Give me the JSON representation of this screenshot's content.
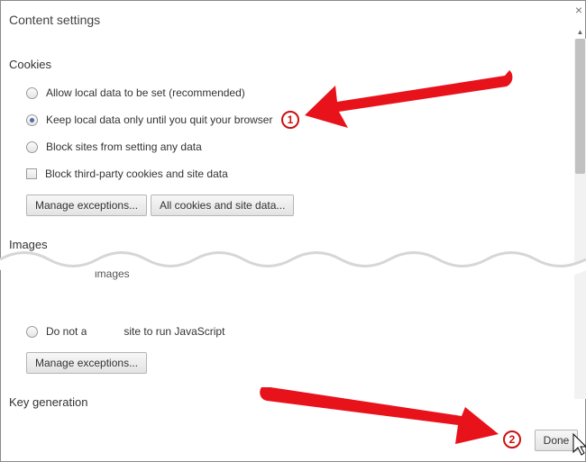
{
  "dialog": {
    "title": "Content settings",
    "close_glyph": "×"
  },
  "cookies": {
    "heading": "Cookies",
    "options": [
      {
        "label": "Allow local data to be set (recommended)",
        "selected": false
      },
      {
        "label": "Keep local data only until you quit your browser",
        "selected": true
      },
      {
        "label": "Block sites from setting any data",
        "selected": false
      }
    ],
    "third_party": {
      "label": "Block third-party cookies and site data",
      "checked": false
    },
    "manage_button": "Manage exceptions...",
    "all_cookies_button": "All cookies and site data..."
  },
  "images": {
    "heading": "Images",
    "partial_text": "images"
  },
  "javascript": {
    "option_part1": "Do not a",
    "option_part2": "site to run JavaScript",
    "manage_button": "Manage exceptions..."
  },
  "key_generation": {
    "heading": "Key generation"
  },
  "footer": {
    "done_button": "Done"
  },
  "annotations": {
    "callout_1": "1",
    "callout_2": "2",
    "arrow_color": "#e8121b"
  }
}
